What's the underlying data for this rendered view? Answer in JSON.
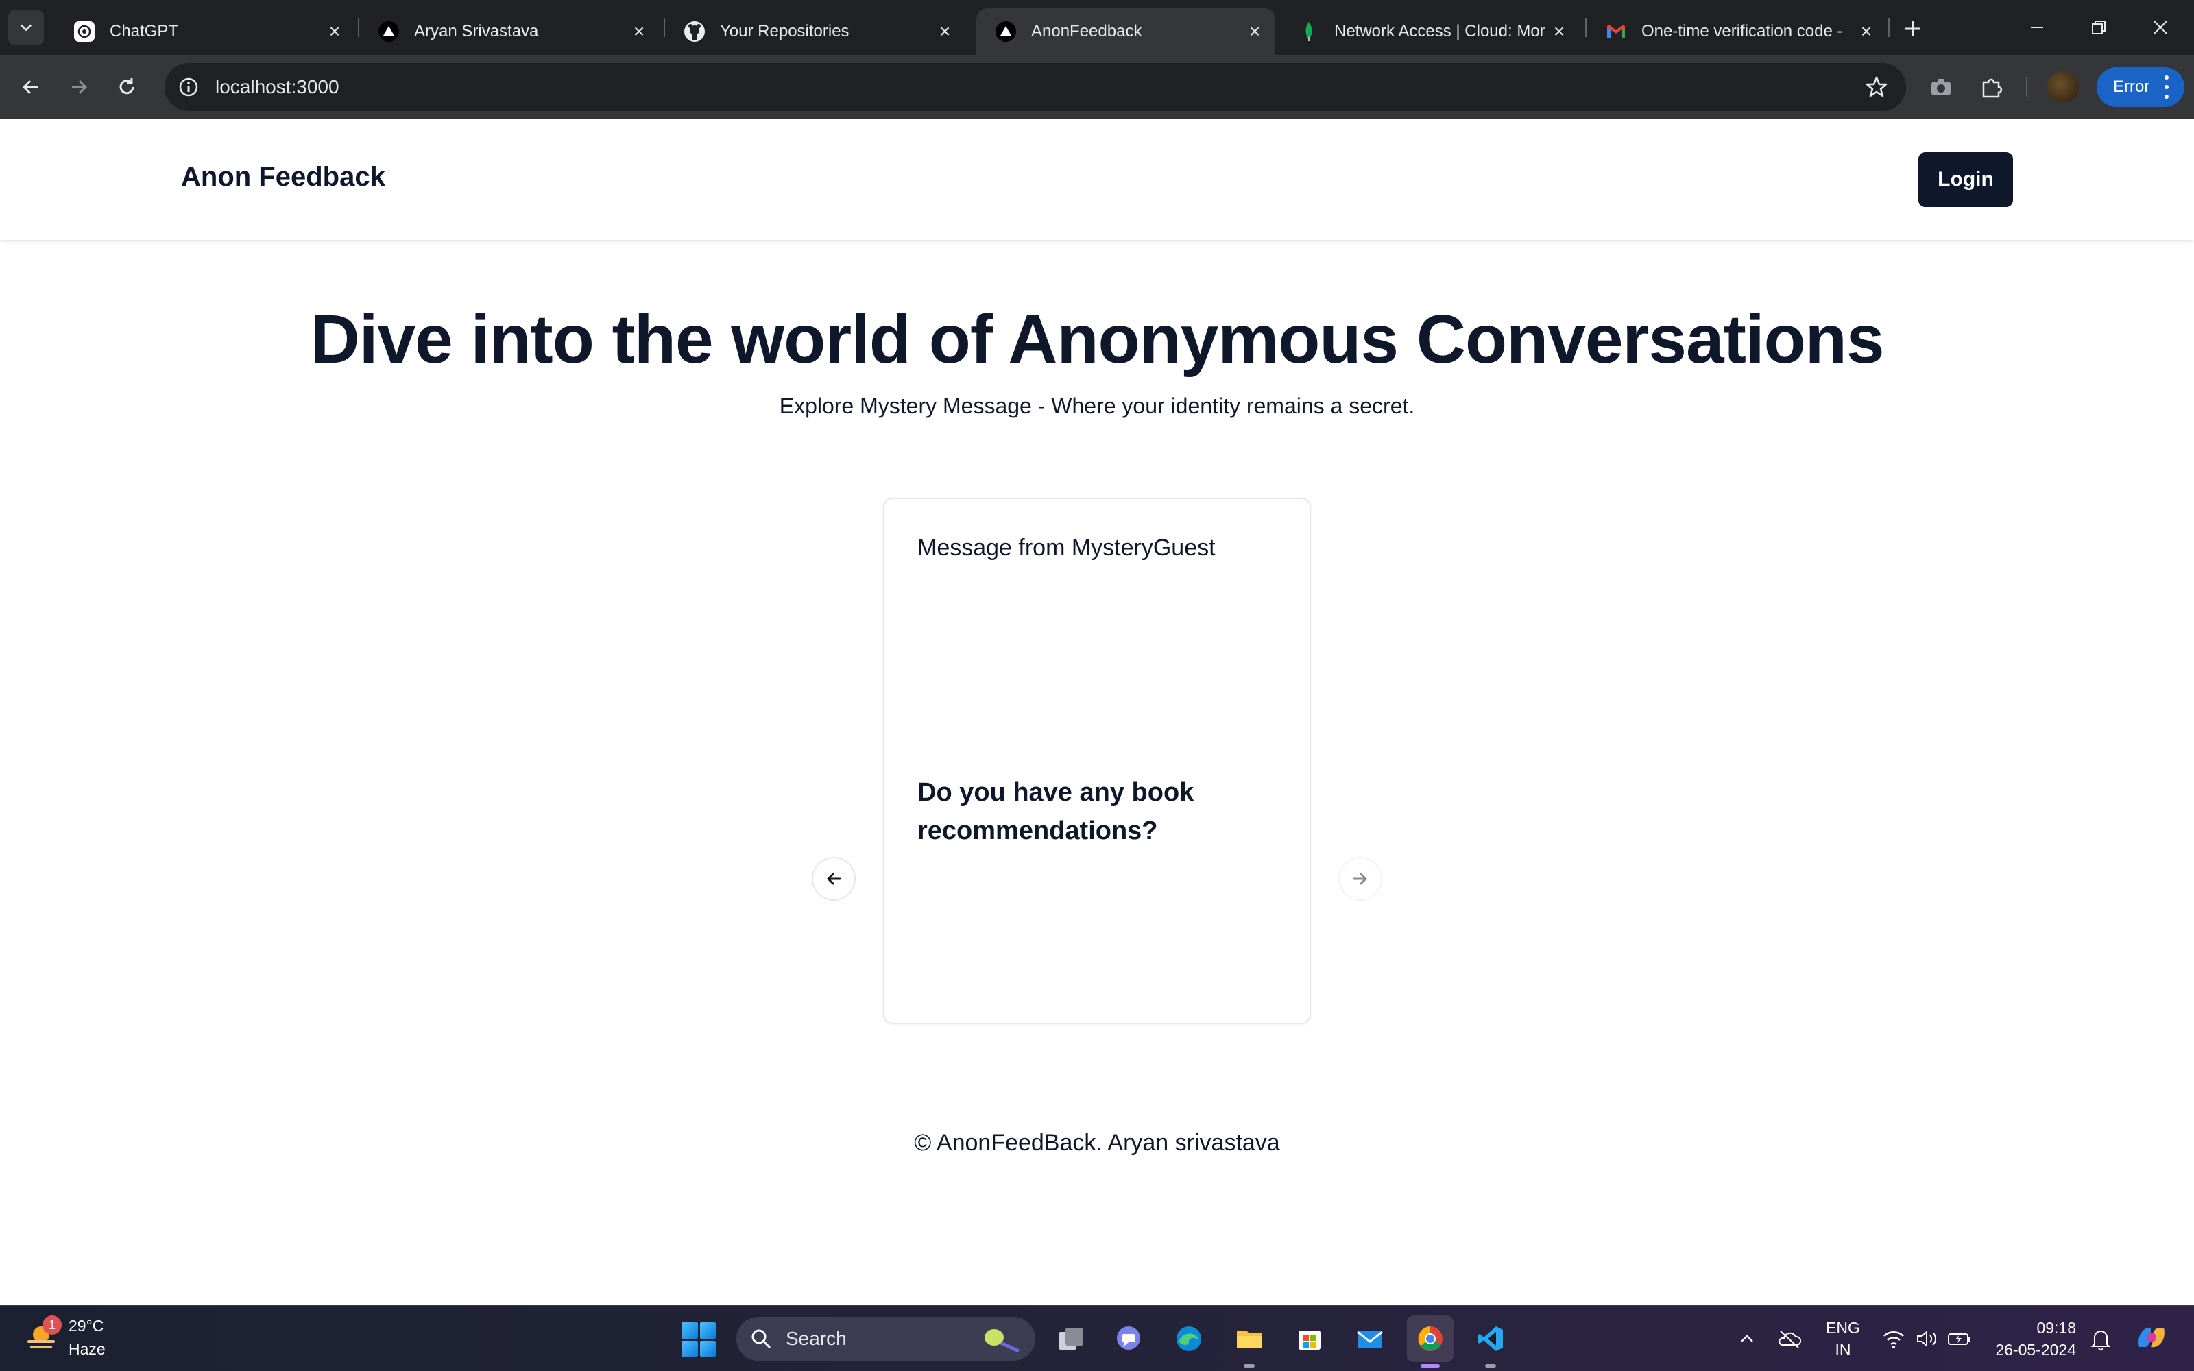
{
  "browser": {
    "tabs": [
      {
        "title": "ChatGPT",
        "icon": "chatgpt-icon",
        "active": false
      },
      {
        "title": "Aryan Srivastava",
        "icon": "vercel-triangle-icon",
        "active": false
      },
      {
        "title": "Your Repositories",
        "icon": "github-icon",
        "active": false
      },
      {
        "title": "AnonFeedback",
        "icon": "vercel-triangle-icon",
        "active": true
      },
      {
        "title": "Network Access | Cloud: Mon",
        "icon": "mongodb-leaf-icon",
        "active": false
      },
      {
        "title": "One-time verification code -",
        "icon": "gmail-icon",
        "active": false
      }
    ],
    "url": "localhost:3000",
    "profile_status": "Error",
    "accent_color": "#1a64c8"
  },
  "site": {
    "brand": "Anon Feedback",
    "login_label": "Login",
    "hero_title": "Dive into the world of Anonymous Conversations",
    "hero_subtitle": "Explore Mystery Message - Where your identity remains a secret.",
    "carousel": {
      "card_title": "Message from MysteryGuest",
      "card_message": "Do you have any book recommendations?"
    },
    "footer": "© AnonFeedBack. Aryan srivastava",
    "primary_color": "#0f172a"
  },
  "taskbar": {
    "weather_badge": "1",
    "weather_temp": "29°C",
    "weather_condition": "Haze",
    "search_placeholder": "Search",
    "lang_line1": "ENG",
    "lang_line2": "IN",
    "time": "09:18",
    "date": "26-05-2024"
  }
}
